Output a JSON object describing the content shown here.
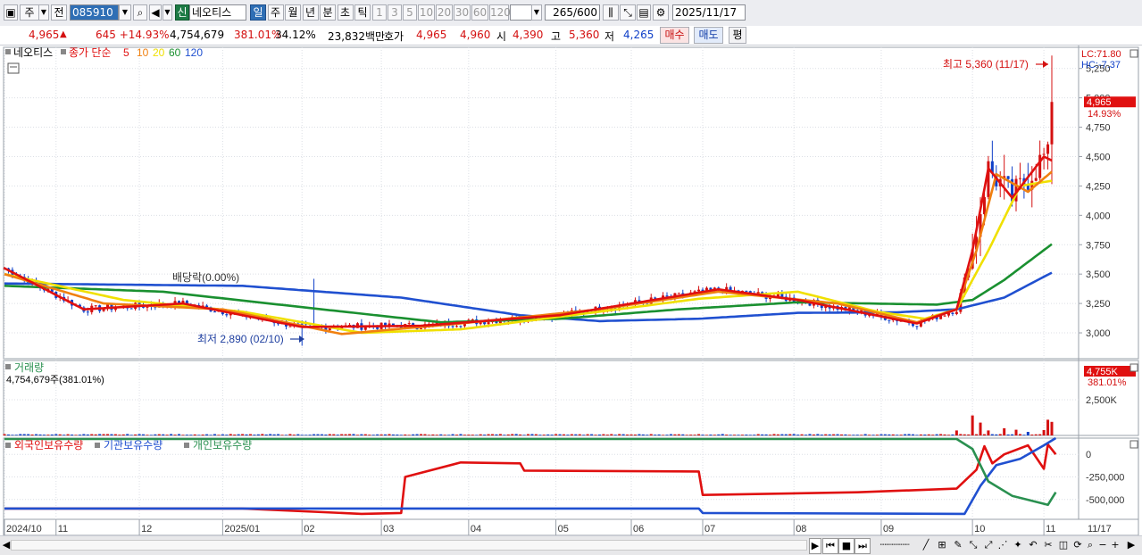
{
  "toolbar": {
    "market": "주",
    "prev_label": "전",
    "code": "085910",
    "new_badge": "신",
    "name": "네오티스",
    "periods": [
      "일",
      "주",
      "월",
      "년",
      "분",
      "초",
      "틱"
    ],
    "selected_period": "일",
    "intervals": [
      "1",
      "3",
      "5",
      "10",
      "20",
      "30",
      "60",
      "120"
    ],
    "count": "265",
    "count_total": "/600",
    "date": "2025/11/17"
  },
  "quote": {
    "price": "4,965",
    "change": "645 +14.93%",
    "volume": "4,754,679",
    "vol_ratio": "381.01%",
    "turnover": "34.12%",
    "amount": "23,832백만",
    "bid_label": "호가",
    "ask": "4,965",
    "bid": "4,960",
    "open_label": "시",
    "open": "4,390",
    "high_label": "고",
    "high": "5,360",
    "low_label": "저",
    "low": "4,265",
    "buy_button": "매수",
    "sell_button": "매도",
    "eval_button": "평"
  },
  "colors": {
    "up": "#d41010",
    "down": "#1040c8",
    "ma5": "#e01010",
    "ma10": "#f08010",
    "ma20": "#f0e000",
    "ma60": "#1a9030",
    "ma120": "#2050d0",
    "foreign": "#e01010",
    "inst": "#2050d0",
    "indiv": "#2a9050"
  },
  "chart_data": {
    "type": "line",
    "price_panel": {
      "legend_name": "네오티스",
      "legend_ma": "종가 단순",
      "ma_periods": [
        "5",
        "10",
        "20",
        "60",
        "120"
      ],
      "lc_label": "LC:71.80",
      "hc_label": "HC:-7.37",
      "max_annotation": "최고 5,360 (11/17)",
      "min_annotation": "최저 2,890 (02/10)",
      "dividend_annotation": "배당락(0.00%)",
      "current_price_tag": "4,965",
      "current_change_tag": "14.93%",
      "y_ticks": [
        "5,250",
        "5,000",
        "4,750",
        "4,500",
        "4,250",
        "4,000",
        "3,750",
        "3,500",
        "3,250",
        "3,000"
      ],
      "y_tick_values": [
        5250,
        5000,
        4750,
        4500,
        4250,
        4000,
        3750,
        3500,
        3250,
        3000
      ],
      "ylim": [
        2780,
        5430
      ],
      "ma_anchor_values": {
        "ma120": [
          [
            0,
            3420
          ],
          [
            60,
            3400
          ],
          [
            100,
            3300
          ],
          [
            130,
            3150
          ],
          [
            150,
            3100
          ],
          [
            175,
            3120
          ],
          [
            200,
            3170
          ],
          [
            225,
            3175
          ],
          [
            240,
            3200
          ],
          [
            252,
            3300
          ],
          [
            265,
            3530
          ]
        ],
        "ma60": [
          [
            0,
            3400
          ],
          [
            40,
            3350
          ],
          [
            80,
            3200
          ],
          [
            110,
            3090
          ],
          [
            140,
            3120
          ],
          [
            170,
            3200
          ],
          [
            200,
            3260
          ],
          [
            235,
            3240
          ],
          [
            244,
            3280
          ],
          [
            252,
            3450
          ],
          [
            265,
            3780
          ]
        ],
        "ma20": [
          [
            0,
            3500
          ],
          [
            30,
            3280
          ],
          [
            60,
            3180
          ],
          [
            90,
            3000
          ],
          [
            115,
            3030
          ],
          [
            150,
            3180
          ],
          [
            175,
            3290
          ],
          [
            200,
            3350
          ],
          [
            220,
            3180
          ],
          [
            232,
            3120
          ],
          [
            240,
            3200
          ],
          [
            248,
            3700
          ],
          [
            256,
            4250
          ],
          [
            265,
            4300
          ]
        ],
        "ma10": [
          [
            0,
            3500
          ],
          [
            25,
            3250
          ],
          [
            55,
            3200
          ],
          [
            85,
            2990
          ],
          [
            115,
            3080
          ],
          [
            150,
            3200
          ],
          [
            180,
            3350
          ],
          [
            210,
            3250
          ],
          [
            230,
            3090
          ],
          [
            240,
            3200
          ],
          [
            245,
            3700
          ],
          [
            250,
            4350
          ],
          [
            258,
            4200
          ],
          [
            265,
            4400
          ]
        ],
        "ma5": [
          [
            0,
            3550
          ],
          [
            20,
            3200
          ],
          [
            45,
            3250
          ],
          [
            75,
            3050
          ],
          [
            105,
            3060
          ],
          [
            140,
            3150
          ],
          [
            180,
            3370
          ],
          [
            200,
            3280
          ],
          [
            230,
            3080
          ],
          [
            240,
            3200
          ],
          [
            244,
            3700
          ],
          [
            248,
            4400
          ],
          [
            254,
            4150
          ],
          [
            262,
            4500
          ],
          [
            265,
            4450
          ]
        ]
      }
    },
    "volume_panel": {
      "title": "거래량",
      "value_label": "4,754,679주(381.01%)",
      "current_tag": "4,755K",
      "current_pct": "381.01%",
      "y_ticks": [
        "2,500K"
      ],
      "y_tick_values": [
        2500000
      ],
      "ylim": [
        0,
        5000000
      ],
      "spikes": [
        [
          240,
          350000
        ],
        [
          244,
          1400000
        ],
        [
          246,
          900000
        ],
        [
          248,
          350000
        ],
        [
          252,
          500000
        ],
        [
          255,
          400000
        ],
        [
          258,
          250000
        ],
        [
          262,
          380000
        ],
        [
          263,
          1100000
        ],
        [
          264,
          950000
        ],
        [
          265,
          4754679
        ]
      ]
    },
    "holdings_panel": {
      "legend": [
        "외국인보유수량",
        "기관보유수량",
        "개인보유수량"
      ],
      "y_ticks": [
        "0",
        "-250,000",
        "-500,000"
      ],
      "y_tick_values": [
        0,
        -250000,
        -500000
      ],
      "ylim": [
        -720000,
        180000
      ]
    },
    "x_ticks": [
      "2024/10",
      "11",
      "12",
      "2025/01",
      "02",
      "03",
      "04",
      "05",
      "06",
      "07",
      "08",
      "09",
      "10",
      "11"
    ],
    "x_tick_index": [
      0,
      13,
      34,
      55,
      75,
      95,
      117,
      139,
      158,
      176,
      199,
      221,
      244,
      262
    ],
    "x_last_label": "11/17",
    "count": 265
  }
}
